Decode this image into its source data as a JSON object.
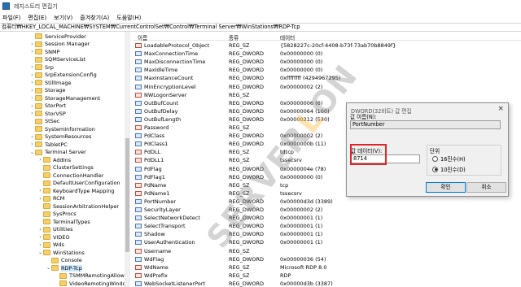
{
  "window": {
    "title": "레지스트리 편집기"
  },
  "menu": [
    "파일(F)",
    "편집(E)",
    "보기(V)",
    "즐겨찾기(A)",
    "도움말(H)"
  ],
  "address": "컴퓨터₩HKEY_LOCAL_MACHINE₩SYSTEM₩CurrentControlSet₩Control₩Terminal Server₩WinStations₩RDP-Tcp",
  "tree": [
    {
      "label": "ServiceProvider",
      "depth": 1,
      "chev": ""
    },
    {
      "label": "Session Manager",
      "depth": 1,
      "chev": "›"
    },
    {
      "label": "SNMP",
      "depth": 1,
      "chev": "›"
    },
    {
      "label": "SQMServiceList",
      "depth": 1,
      "chev": ""
    },
    {
      "label": "Srp",
      "depth": 1,
      "chev": "›"
    },
    {
      "label": "SrpExtensionConfig",
      "depth": 1,
      "chev": "›"
    },
    {
      "label": "StillImage",
      "depth": 1,
      "chev": "›"
    },
    {
      "label": "Storage",
      "depth": 1,
      "chev": "›"
    },
    {
      "label": "StorageManagement",
      "depth": 1,
      "chev": "›"
    },
    {
      "label": "StorPort",
      "depth": 1,
      "chev": "›"
    },
    {
      "label": "StorVSP",
      "depth": 1,
      "chev": "›"
    },
    {
      "label": "StSec",
      "depth": 1,
      "chev": ""
    },
    {
      "label": "SystemInformation",
      "depth": 1,
      "chev": ""
    },
    {
      "label": "SystemResources",
      "depth": 1,
      "chev": "›"
    },
    {
      "label": "TabletPC",
      "depth": 1,
      "chev": "›"
    },
    {
      "label": "Terminal Server",
      "depth": 1,
      "chev": "⌄"
    },
    {
      "label": "AddIns",
      "depth": 2,
      "chev": "›"
    },
    {
      "label": "ClusterSettings",
      "depth": 2,
      "chev": ""
    },
    {
      "label": "ConnectionHandler",
      "depth": 2,
      "chev": ""
    },
    {
      "label": "DefaultUserConfiguration",
      "depth": 2,
      "chev": ""
    },
    {
      "label": "KeyboardType Mapping",
      "depth": 2,
      "chev": "›"
    },
    {
      "label": "RCM",
      "depth": 2,
      "chev": "›"
    },
    {
      "label": "SessionArbitrationHelper",
      "depth": 2,
      "chev": ""
    },
    {
      "label": "SysProcs",
      "depth": 2,
      "chev": ""
    },
    {
      "label": "TerminalTypes",
      "depth": 2,
      "chev": ""
    },
    {
      "label": "Utilities",
      "depth": 2,
      "chev": "›"
    },
    {
      "label": "VIDEO",
      "depth": 2,
      "chev": "›"
    },
    {
      "label": "Wds",
      "depth": 2,
      "chev": "›"
    },
    {
      "label": "WinStations",
      "depth": 2,
      "chev": "⌄"
    },
    {
      "label": "Console",
      "depth": 3,
      "chev": ""
    },
    {
      "label": "RDP-Tcp",
      "depth": 3,
      "chev": "⌄",
      "selected": true
    },
    {
      "label": "TSMMRemotingAllow",
      "depth": 4,
      "chev": ""
    },
    {
      "label": "VideoRemotingWindo",
      "depth": 4,
      "chev": ""
    }
  ],
  "list": {
    "headers": {
      "name": "이름",
      "type": "종류",
      "data": "데이터"
    },
    "rows": [
      {
        "name": "LoadableProtocol_Object",
        "type": "REG_SZ",
        "data": "{5828227c-20cf-4408-b73f-73ab70b8849f}",
        "icon": "string"
      },
      {
        "name": "MaxConnectionTime",
        "type": "REG_DWORD",
        "data": "0x00000000 (0)",
        "icon": "binary"
      },
      {
        "name": "MaxDisconnectionTime",
        "type": "REG_DWORD",
        "data": "0x00000000 (0)",
        "icon": "binary"
      },
      {
        "name": "MaxIdleTime",
        "type": "REG_DWORD",
        "data": "0x00000000 (0)",
        "icon": "binary"
      },
      {
        "name": "MaxInstanceCount",
        "type": "REG_DWORD",
        "data": "0xffffffff (4294967295)",
        "icon": "binary"
      },
      {
        "name": "MinEncryptionLevel",
        "type": "REG_DWORD",
        "data": "0x00000002 (2)",
        "icon": "binary"
      },
      {
        "name": "NWLogonServer",
        "type": "REG_SZ",
        "data": "",
        "icon": "string"
      },
      {
        "name": "OutBufCount",
        "type": "REG_DWORD",
        "data": "0x00000006 (6)",
        "icon": "binary"
      },
      {
        "name": "OutBufDelay",
        "type": "REG_DWORD",
        "data": "0x00000064 (100)",
        "icon": "binary"
      },
      {
        "name": "OutBufLength",
        "type": "REG_DWORD",
        "data": "0x00000212 (530)",
        "icon": "binary"
      },
      {
        "name": "Password",
        "type": "REG_SZ",
        "data": "",
        "icon": "string"
      },
      {
        "name": "PdClass",
        "type": "REG_DWORD",
        "data": "0x00000002 (2)",
        "icon": "binary"
      },
      {
        "name": "PdClass1",
        "type": "REG_DWORD",
        "data": "0x0000000b (11)",
        "icon": "binary"
      },
      {
        "name": "PdDLL",
        "type": "REG_SZ",
        "data": "tdtcp",
        "icon": "string"
      },
      {
        "name": "PdDLL1",
        "type": "REG_SZ",
        "data": "tssecsrv",
        "icon": "string"
      },
      {
        "name": "PdFlag",
        "type": "REG_DWORD",
        "data": "0x0000004e (78)",
        "icon": "binary"
      },
      {
        "name": "PdFlag1",
        "type": "REG_DWORD",
        "data": "0x00000000 (0)",
        "icon": "binary"
      },
      {
        "name": "PdName",
        "type": "REG_SZ",
        "data": "tcp",
        "icon": "string"
      },
      {
        "name": "PdName1",
        "type": "REG_SZ",
        "data": "tssecsrv",
        "icon": "string"
      },
      {
        "name": "PortNumber",
        "type": "REG_DWORD",
        "data": "0x00000d3d (3389)",
        "icon": "binary"
      },
      {
        "name": "SecurityLayer",
        "type": "REG_DWORD",
        "data": "0x00000002 (2)",
        "icon": "binary"
      },
      {
        "name": "SelectNetworkDetect",
        "type": "REG_DWORD",
        "data": "0x00000001 (1)",
        "icon": "binary"
      },
      {
        "name": "SelectTransport",
        "type": "REG_DWORD",
        "data": "0x00000001 (1)",
        "icon": "binary"
      },
      {
        "name": "Shadow",
        "type": "REG_DWORD",
        "data": "0x00000001 (1)",
        "icon": "binary"
      },
      {
        "name": "UserAuthentication",
        "type": "REG_DWORD",
        "data": "0x00000001 (1)",
        "icon": "binary"
      },
      {
        "name": "Username",
        "type": "REG_SZ",
        "data": "",
        "icon": "string"
      },
      {
        "name": "WdFlag",
        "type": "REG_DWORD",
        "data": "0x00000036 (54)",
        "icon": "binary"
      },
      {
        "name": "WdName",
        "type": "REG_SZ",
        "data": "Microsoft RDP 8.0",
        "icon": "string"
      },
      {
        "name": "WdPrefix",
        "type": "REG_SZ",
        "data": "RDP",
        "icon": "string"
      },
      {
        "name": "WebSocketListenerPort",
        "type": "REG_DWORD",
        "data": "0x00000d3b (3387)",
        "icon": "binary"
      }
    ]
  },
  "dialog": {
    "title": "DWORD(32비트) 값 편집",
    "close": "×",
    "value_name_label": "값 이름(N):",
    "value_name": "PortNumber",
    "value_data_label": "값 데이터(V):",
    "value_data": "8714",
    "base_label": "단위",
    "hex_label": "16진수(H)",
    "dec_label": "10진수(D)",
    "base_selected": "dec",
    "ok": "확인",
    "cancel": "취소",
    "highlight_color": "#e0242a"
  },
  "watermark": {
    "pre": "SERVER",
    "mid": "L",
    "post": "ON"
  }
}
